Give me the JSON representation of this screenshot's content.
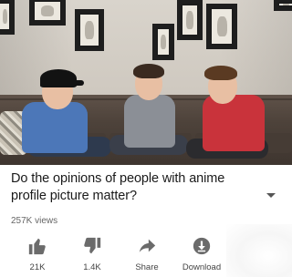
{
  "video": {
    "title": "Do the opinions of people with anime profile picture matter?",
    "views": "257K views",
    "more_icon": "chevron-down-icon"
  },
  "actions": {
    "like": {
      "label": "21K",
      "icon": "thumbs-up-icon"
    },
    "dislike": {
      "label": "1.4K",
      "icon": "thumbs-down-icon"
    },
    "share": {
      "label": "Share",
      "icon": "share-arrow-icon"
    },
    "download": {
      "label": "Download",
      "icon": "download-icon"
    }
  },
  "colors": {
    "icon": "#6b6b6b",
    "text": "#1a1a1a",
    "meta": "#666666"
  }
}
